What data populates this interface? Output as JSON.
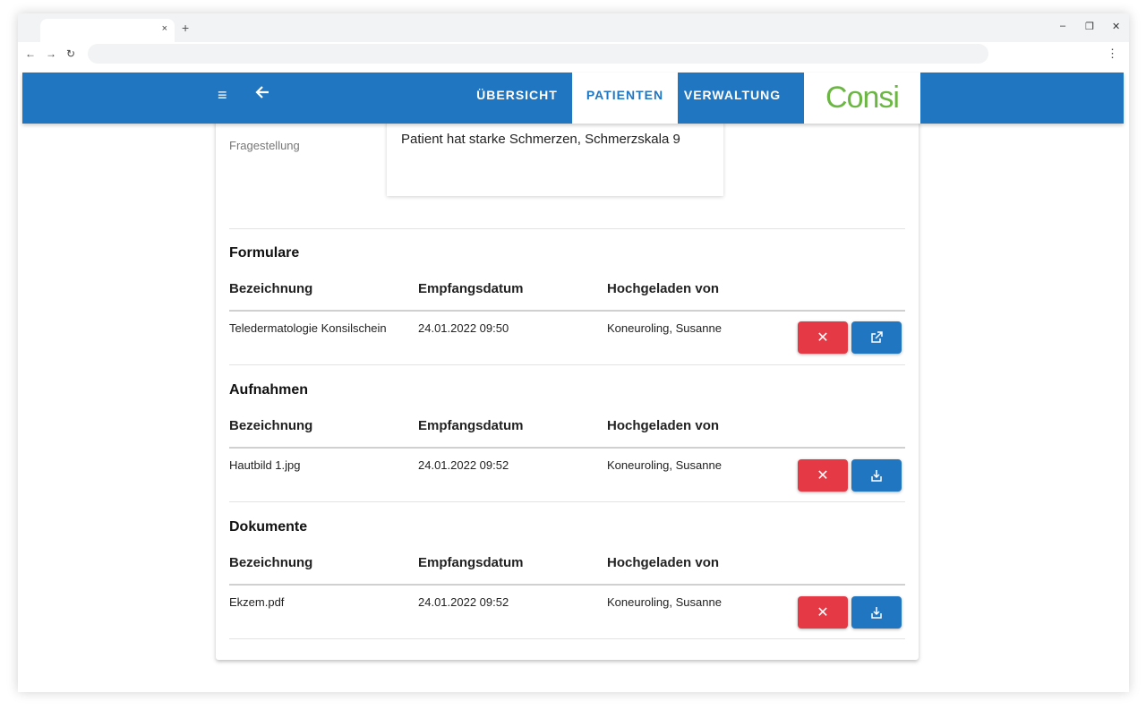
{
  "browser": {
    "tab_close": "×",
    "new_tab": "+",
    "minimize": "–",
    "restore": "❐",
    "close": "✕",
    "back": "←",
    "forward": "→",
    "reload": "↻",
    "menu": "⋮"
  },
  "appbar": {
    "menu_icon": "≡",
    "back_icon": "🡐",
    "tabs": [
      {
        "label": "ÜBERSICHT"
      },
      {
        "label": "PATIENTEN"
      },
      {
        "label": "VERWALTUNG"
      }
    ],
    "active_tab": "PATIENTEN",
    "logo_text": "Consi",
    "accent_color": "#2176c2",
    "logo_color": "#6cb644"
  },
  "fragestellung": {
    "label": "Fragestellung",
    "value": "Patient hat starke Schmerzen, Schmerzskala 9"
  },
  "columns": {
    "name": "Bezeichnung",
    "date": "Empfangsdatum",
    "uploader": "Hochgeladen von"
  },
  "sections": [
    {
      "title": "Formulare",
      "rows": [
        {
          "name": "Teledermatologie Konsilschein",
          "date": "24.01.2022 09:50",
          "uploader": "Koneuroling, Susanne",
          "action_icon": "external-link-icon"
        }
      ]
    },
    {
      "title": "Aufnahmen",
      "rows": [
        {
          "name": "Hautbild 1.jpg",
          "date": "24.01.2022 09:52",
          "uploader": "Koneuroling, Susanne",
          "action_icon": "download-icon"
        }
      ]
    },
    {
      "title": "Dokumente",
      "rows": [
        {
          "name": "Ekzem.pdf",
          "date": "24.01.2022 09:52",
          "uploader": "Koneuroling, Susanne",
          "action_icon": "download-icon"
        }
      ]
    }
  ],
  "buttons": {
    "delete_glyph": "✕",
    "delete_color": "#e53946"
  }
}
